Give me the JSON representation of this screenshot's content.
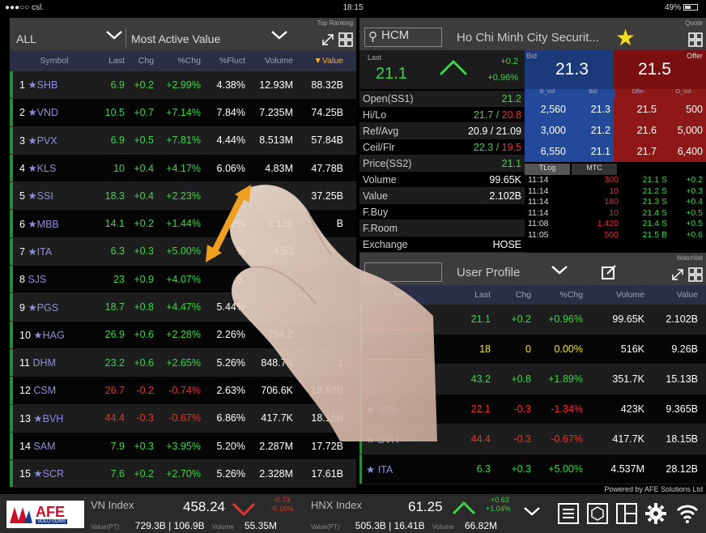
{
  "status": {
    "carrier": "●●●○○ csl.",
    "time": "18:15",
    "battery": "49%"
  },
  "ranking": {
    "filter": "ALL",
    "type": "Most Active Value",
    "tag": "Top Ranking",
    "columns": [
      "Symbol",
      "Last",
      "Chg",
      "%Chg",
      "%Fluct",
      "Volume",
      "Value"
    ],
    "rows": [
      {
        "n": "1",
        "sym": "SHB",
        "star": true,
        "last": "6.9",
        "chg": "+0.2",
        "pchg": "+2.99%",
        "fluct": "4.38%",
        "vol": "12.93M",
        "val": "88.32B",
        "dir": "up"
      },
      {
        "n": "2",
        "sym": "VND",
        "star": true,
        "last": "10.5",
        "chg": "+0.7",
        "pchg": "+7.14%",
        "fluct": "7.84%",
        "vol": "7.235M",
        "val": "74.25B",
        "dir": "up"
      },
      {
        "n": "3",
        "sym": "PVX",
        "star": true,
        "last": "6.9",
        "chg": "+0.5",
        "pchg": "+7.81%",
        "fluct": "4.44%",
        "vol": "8.513M",
        "val": "57.84B",
        "dir": "up"
      },
      {
        "n": "4",
        "sym": "KLS",
        "star": true,
        "last": "10",
        "chg": "+0.4",
        "pchg": "+4.17%",
        "fluct": "6.06%",
        "vol": "4.83M",
        "val": "47.78B",
        "dir": "up"
      },
      {
        "n": "5",
        "sym": "SSI",
        "star": true,
        "last": "18.3",
        "chg": "+0.4",
        "pchg": "+2.23%",
        "fluct": "3",
        "vol": "",
        "val": "37.25B",
        "dir": "up"
      },
      {
        "n": "6",
        "sym": "MBB",
        "star": true,
        "last": "14.1",
        "chg": "+0.2",
        "pchg": "+1.44%",
        "fluct": "82%",
        "vol": "2.139",
        "val": "B",
        "dir": "up"
      },
      {
        "n": "7",
        "sym": "ITA",
        "star": true,
        "last": "6.3",
        "chg": "+0.3",
        "pchg": "+5.00%",
        "fluct": "%",
        "vol": "4.53",
        "val": "",
        "dir": "up"
      },
      {
        "n": "8",
        "sym": "SJS",
        "star": false,
        "last": "23",
        "chg": "+0.9",
        "pchg": "+4.07%",
        "fluct": "5.",
        "vol": "",
        "val": "",
        "dir": "up"
      },
      {
        "n": "9",
        "sym": "PGS",
        "star": true,
        "last": "18.7",
        "chg": "+0.8",
        "pchg": "+4.47%",
        "fluct": "5.44%",
        "vol": "",
        "val": "",
        "dir": "up"
      },
      {
        "n": "10",
        "sym": "HAG",
        "star": true,
        "last": "26.9",
        "chg": "+0.6",
        "pchg": "+2.28%",
        "fluct": "2.26%",
        "vol": "794.2",
        "val": "",
        "dir": "up"
      },
      {
        "n": "11",
        "sym": "DHM",
        "star": false,
        "last": "23.2",
        "chg": "+0.6",
        "pchg": "+2.65%",
        "fluct": "5.26%",
        "vol": "848.7K",
        "val": "1",
        "dir": "up"
      },
      {
        "n": "12",
        "sym": "CSM",
        "star": false,
        "last": "26.7",
        "chg": "-0.2",
        "pchg": "-0.74%",
        "fluct": "2.63%",
        "vol": "706.6K",
        "val": "18.92B",
        "dir": "down"
      },
      {
        "n": "13",
        "sym": "BVH",
        "star": true,
        "last": "44.4",
        "chg": "-0.3",
        "pchg": "-0.67%",
        "fluct": "6.86%",
        "vol": "417.7K",
        "val": "18.15B",
        "dir": "down"
      },
      {
        "n": "14",
        "sym": "SAM",
        "star": false,
        "last": "7.9",
        "chg": "+0.3",
        "pchg": "+3.95%",
        "fluct": "5.20%",
        "vol": "2.287M",
        "val": "17.72B",
        "dir": "up"
      },
      {
        "n": "15",
        "sym": "SCR",
        "star": true,
        "last": "7.6",
        "chg": "+0.2",
        "pchg": "+2.70%",
        "fluct": "5.26%",
        "vol": "2.328M",
        "val": "17.61B",
        "dir": "up"
      }
    ]
  },
  "quote": {
    "search": "HCM",
    "title": "Ho Chi Minh City Securit...",
    "tag": "Quote",
    "last_label": "Last",
    "last": "21.1",
    "chg": "+0.2",
    "pchg": "+0.96%",
    "bid_label": "Bid",
    "bid": "21.3",
    "offer_label": "Offer",
    "offer": "21.5",
    "info": [
      {
        "k": "Open(SS1)",
        "v": "21.2",
        "cls": "up"
      },
      {
        "k": "Hi/Lo",
        "v": "21.7 / 20.8",
        "cls": "mixed"
      },
      {
        "k": "Ref/Avg",
        "v": "20.9 / 21.09",
        "cls": "white"
      },
      {
        "k": "Ceil/Flr",
        "v": "22.3 / 19.5",
        "cls": "mixed2"
      },
      {
        "k": "Price(SS2)",
        "v": "21.1",
        "cls": "up"
      },
      {
        "k": "Volume",
        "v": "99.65K",
        "cls": "white"
      },
      {
        "k": "Value",
        "v": "2.102B",
        "cls": "white"
      },
      {
        "k": "F.Buy",
        "v": "",
        "cls": "white"
      },
      {
        "k": "F.Room",
        "v": "",
        "cls": "white"
      },
      {
        "k": "Exchange",
        "v": "HOSE",
        "cls": "white"
      }
    ],
    "depth_head": [
      "B_Vol",
      "Bid",
      "Offer",
      "O_Vol"
    ],
    "depth": [
      {
        "bv": "2,560",
        "bp": "21.3",
        "op": "21.5",
        "ov": "500"
      },
      {
        "bv": "3,000",
        "bp": "21.2",
        "op": "21.6",
        "ov": "5,000"
      },
      {
        "bv": "6,550",
        "bp": "21.1",
        "op": "21.7",
        "ov": "6,400"
      }
    ],
    "tabs": [
      "TLog",
      "MTC"
    ],
    "tlog": [
      {
        "t": "11:14",
        "v": "300",
        "p": "21.1 S",
        "c": "+0.2"
      },
      {
        "t": "11:14",
        "v": "10",
        "p": "21.2 S",
        "c": "+0.3"
      },
      {
        "t": "11:14",
        "v": "180",
        "p": "21.3 S",
        "c": "+0.4"
      },
      {
        "t": "11:14",
        "v": "10",
        "p": "21.4 S",
        "c": "+0.5"
      },
      {
        "t": "11:08",
        "v": "1,420",
        "p": "21.4 S",
        "c": "+0.5"
      },
      {
        "t": "11:05",
        "v": "500",
        "p": "21.5 B",
        "c": "+0.6"
      }
    ]
  },
  "watchlist": {
    "profile": "User Profile",
    "tag": "Watchlist",
    "columns": [
      "bol",
      "Last",
      "Chg",
      "%Chg",
      "Volume",
      "Value"
    ],
    "rows": [
      {
        "sym": "",
        "star": false,
        "last": "21.1",
        "chg": "+0.2",
        "pchg": "+0.96%",
        "vol": "99.65K",
        "val": "2.102B",
        "dir": "up"
      },
      {
        "sym": "",
        "star": false,
        "last": "18",
        "chg": "0",
        "pchg": "0.00%",
        "vol": "516K",
        "val": "9.26B",
        "dir": "flat"
      },
      {
        "sym": "",
        "star": false,
        "last": "43.2",
        "chg": "+0.8",
        "pchg": "+1.89%",
        "vol": "351.7K",
        "val": "15.13B",
        "dir": "up"
      },
      {
        "sym": "STB",
        "star": true,
        "last": "22.1",
        "chg": "-0.3",
        "pchg": "-1.34%",
        "vol": "423K",
        "val": "9.365B",
        "dir": "down"
      },
      {
        "sym": "BVH",
        "star": true,
        "last": "44.4",
        "chg": "-0.3",
        "pchg": "-0.67%",
        "vol": "417.7K",
        "val": "18.15B",
        "dir": "down"
      },
      {
        "sym": "ITA",
        "star": true,
        "last": "6.3",
        "chg": "+0.3",
        "pchg": "+5.00%",
        "vol": "4.537M",
        "val": "28.12B",
        "dir": "up"
      }
    ],
    "powered": "Powered by AFE Solutions Ltd"
  },
  "bottom": {
    "logo": "AFE",
    "logo_sub": "SOLUTIONS",
    "vn_label": "VN Index",
    "vn_val": "458.24",
    "vn_chg": "-0.73",
    "vn_pchg": "-0.16%",
    "vn_value_label": "Value(PT)",
    "vn_value": "729.3B | 106.9B",
    "vn_volume_label": "Volume",
    "vn_volume": "55.35M",
    "hnx_label": "HNX Index",
    "hnx_val": "61.25",
    "hnx_chg": "+0.63",
    "hnx_pchg": "+1.04%",
    "hnx_value_label": "Value(PT)",
    "hnx_value": "505.3B | 16.41B",
    "hnx_volume_label": "Volume",
    "hnx_volume": "66.82M"
  }
}
